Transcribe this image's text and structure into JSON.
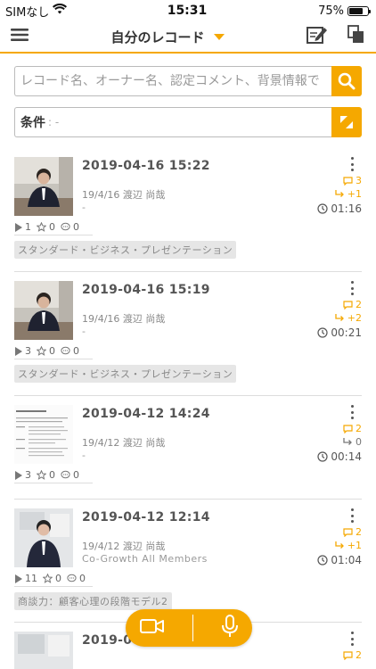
{
  "status": {
    "carrier": "SIMなし",
    "time": "15:31",
    "battery": "75%",
    "battery_level": 0.75
  },
  "nav": {
    "title": "自分のレコード"
  },
  "search": {
    "placeholder": "レコード名、オーナー名、認定コメント、背景情報で"
  },
  "condition": {
    "label": "条件",
    "value": ": -"
  },
  "records": [
    {
      "datetime": "2019-04-16 15:22",
      "sub": "19/4/16 渡辺 尚哉",
      "group": "-",
      "comments": "3",
      "share": "+1",
      "share_color": "#f5a800",
      "duration": "01:16",
      "plays": "1",
      "stars": "0",
      "notes": "0",
      "tag": "スタンダード・ビジネス・プレゼンテーション",
      "thumb": "person-dark"
    },
    {
      "datetime": "2019-04-16 15:19",
      "sub": "19/4/16 渡辺 尚哉",
      "group": "-",
      "comments": "2",
      "share": "+2",
      "share_color": "#f5a800",
      "duration": "00:21",
      "plays": "3",
      "stars": "0",
      "notes": "0",
      "tag": "スタンダード・ビジネス・プレゼンテーション",
      "thumb": "person-dark"
    },
    {
      "datetime": "2019-04-12 14:24",
      "sub": "19/4/12 渡辺 尚哉",
      "group": "-",
      "comments": "2",
      "share": "0",
      "share_color": "#777777",
      "duration": "00:14",
      "plays": "3",
      "stars": "0",
      "notes": "0",
      "tag": "",
      "thumb": "document"
    },
    {
      "datetime": "2019-04-12 12:14",
      "sub": "19/4/12 渡辺 尚哉",
      "group": "Co-Growth All Members",
      "comments": "2",
      "share": "+1",
      "share_color": "#f5a800",
      "duration": "01:04",
      "plays": "11",
      "stars": "0",
      "notes": "0",
      "tag": "商談力：顧客心理の段階モデル2",
      "thumb": "person-light"
    },
    {
      "datetime": "2019-0",
      "sub": "",
      "group": "",
      "comments": "2",
      "share": "",
      "share_color": "#f5a800",
      "duration": "",
      "plays": "",
      "stars": "",
      "notes": "",
      "tag": "",
      "thumb": "person-light"
    }
  ]
}
